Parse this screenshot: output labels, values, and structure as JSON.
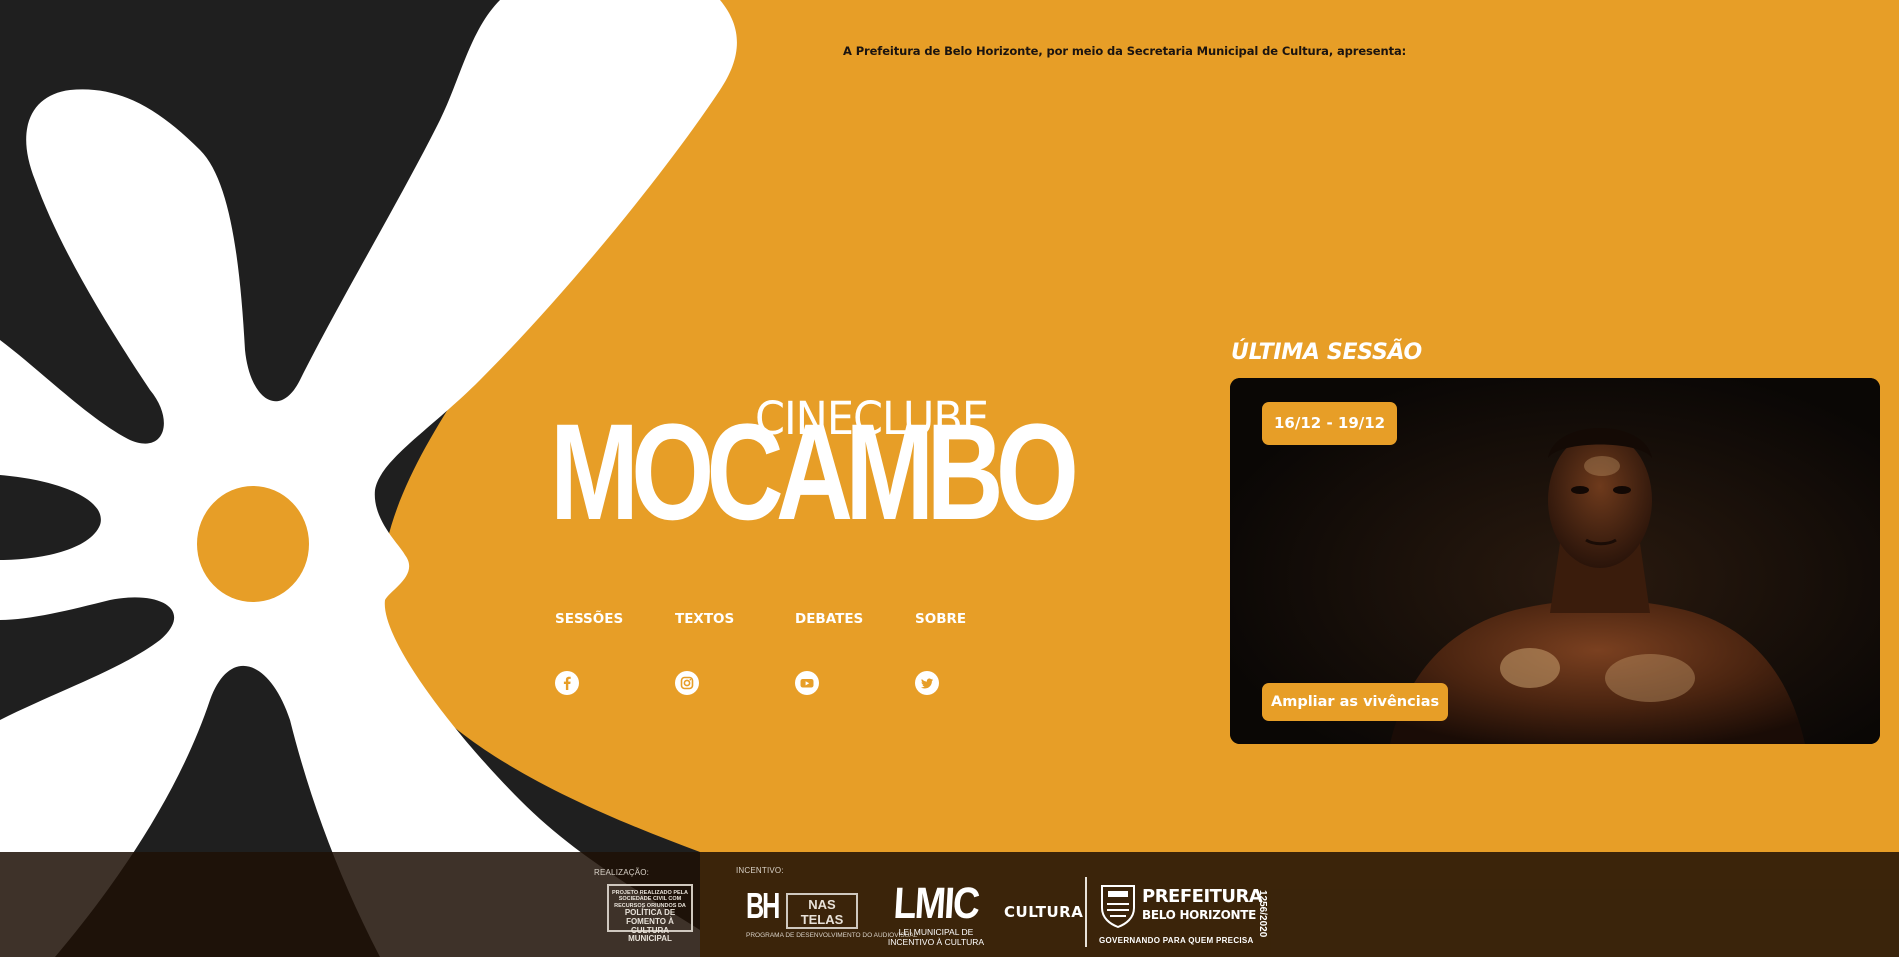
{
  "colors": {
    "accent": "#E79E27",
    "dark": "#1f1f1f",
    "white": "#ffffff",
    "footer": "#1e1006"
  },
  "intro": "A Prefeitura de Belo Horizonte, por meio da Secretaria Municipal de Cultura, apresenta:",
  "logo": {
    "line1": "CINECLUBE",
    "line2": "MOCAMBO"
  },
  "nav": [
    {
      "label": "SESSÕES"
    },
    {
      "label": "TEXTOS"
    },
    {
      "label": "DEBATES"
    },
    {
      "label": "SOBRE"
    }
  ],
  "socials": [
    {
      "icon": "facebook-icon"
    },
    {
      "icon": "instagram-icon"
    },
    {
      "icon": "youtube-icon"
    },
    {
      "icon": "twitter-icon"
    }
  ],
  "last_session": {
    "title": "ÚLTIMA SESSÃO",
    "date_badge": "16/12 - 19/12",
    "button": "Ampliar as vivências"
  },
  "footer": {
    "realizacao_label": "REALIZAÇÃO:",
    "realizacao_box_small": "PROJETO REALIZADO PELA SOCIEDADE CIVIL COM RECURSOS ORIUNDOS DA",
    "realizacao_box_big": "POLÍTICA DE FOMENTO À CULTURA MUNICIPAL",
    "incentivo_label": "INCENTIVO:",
    "bh_big": "BH",
    "bh_box": "NAS TELAS",
    "bh_sub": "PROGRAMA DE DESENVOLVIMENTO DO AUDIOVISUAL",
    "lmic_big": "LMIC",
    "lmic_sub": "LEI MUNICIPAL DE INCENTIVO À CULTURA",
    "cultura": "CULTURA",
    "pbh_title": "PREFEITURA",
    "pbh_sub": "BELO HORIZONTE",
    "pbh_tag": "GOVERNANDO PARA QUEM PRECISA",
    "project_number": "1256/2020"
  }
}
